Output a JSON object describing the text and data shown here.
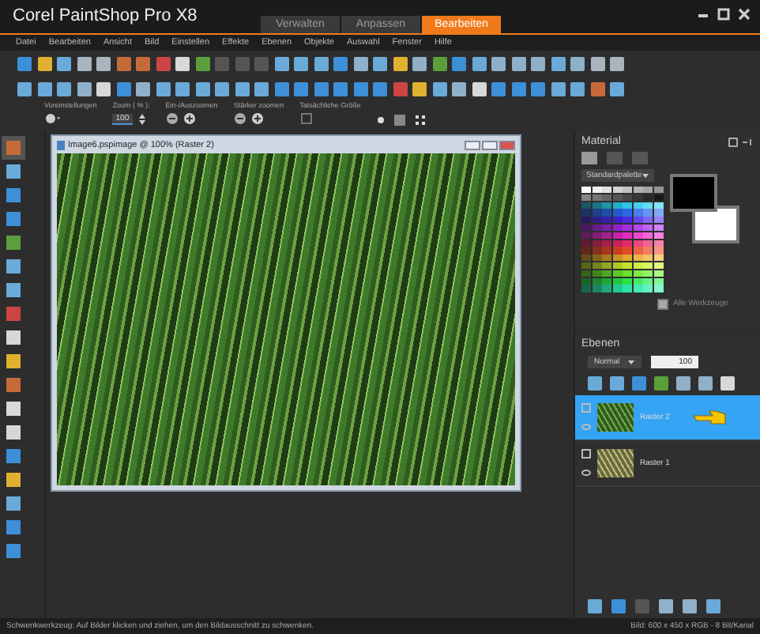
{
  "window": {
    "title": "Corel PaintShop Pro X8"
  },
  "workspace_tabs": [
    {
      "label": "Verwalten",
      "selected": false
    },
    {
      "label": "Anpassen",
      "selected": false
    },
    {
      "label": "Bearbeiten",
      "selected": true
    }
  ],
  "menu": [
    "Datei",
    "Bearbeiten",
    "Ansicht",
    "Bild",
    "Einstellen",
    "Effekte",
    "Ebenen",
    "Objekte",
    "Auswahl",
    "Fenster",
    "Hilfe"
  ],
  "options_bar": [
    {
      "label": "Voreinstellungen",
      "kind": "preset"
    },
    {
      "label": "Zoom ( % ):",
      "kind": "field",
      "value": "100"
    },
    {
      "label": "Ein-/Auszoomen",
      "kind": "pair"
    },
    {
      "label": "Stärker zoomen",
      "kind": "pair"
    },
    {
      "label": "Tatsächliche Größe",
      "kind": "single"
    }
  ],
  "document": {
    "title": "Image6.pspimage @ 100% (Raster 2)"
  },
  "material": {
    "title": "Material",
    "palette": "Standardpalette",
    "swatches": [
      {
        "kind": "foreground",
        "color": "#000000"
      },
      {
        "kind": "background",
        "color": "#ffffff"
      }
    ],
    "all_tools": {
      "label": "Alle Werkzeuge",
      "checked": true
    }
  },
  "layers": {
    "title": "Ebenen",
    "blend_mode": "Normal",
    "opacity": "100",
    "items": [
      {
        "name": "Raster 2",
        "selected": true
      },
      {
        "name": "Raster 1",
        "selected": false
      }
    ]
  },
  "status_bar": {
    "message": "Schwenkwerkzeug: Auf Bilder klicken und ziehen, um den Bildausschnitt zu schwenken.",
    "image_info": "Bild: 600 x 450 x RGB - 8 Bit/Kanal"
  }
}
